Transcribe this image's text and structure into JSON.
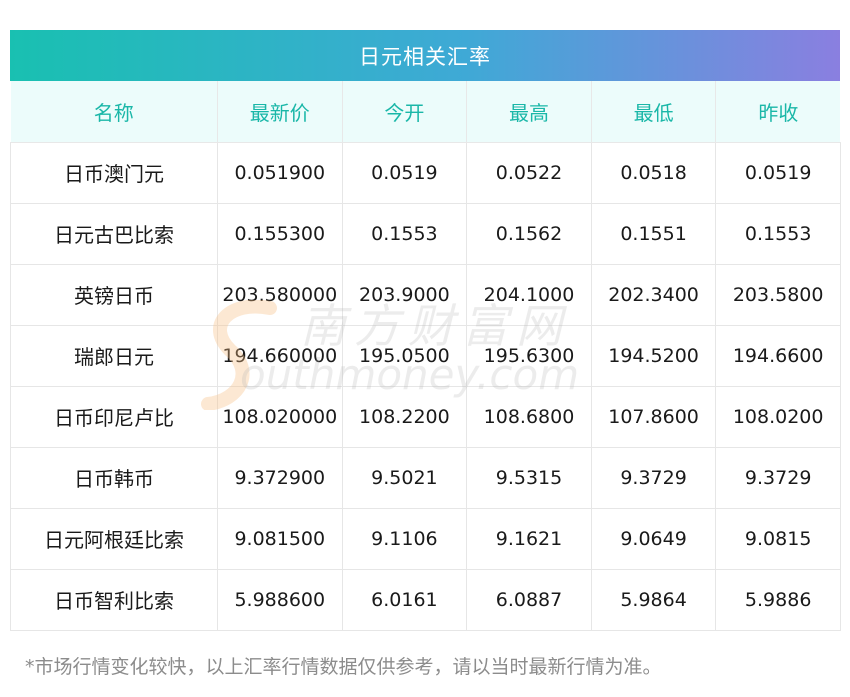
{
  "title": "日元相关汇率",
  "headers": [
    "名称",
    "最新价",
    "今开",
    "最高",
    "最低",
    "昨收"
  ],
  "rows": [
    [
      "日币澳门元",
      "0.051900",
      "0.0519",
      "0.0522",
      "0.0518",
      "0.0519"
    ],
    [
      "日元古巴比索",
      "0.155300",
      "0.1553",
      "0.1562",
      "0.1551",
      "0.1553"
    ],
    [
      "英镑日币",
      "203.580000",
      "203.9000",
      "204.1000",
      "202.3400",
      "203.5800"
    ],
    [
      "瑞郎日元",
      "194.660000",
      "195.0500",
      "195.6300",
      "194.5200",
      "194.6600"
    ],
    [
      "日币印尼卢比",
      "108.020000",
      "108.2200",
      "108.6800",
      "107.8600",
      "108.0200"
    ],
    [
      "日币韩币",
      "9.372900",
      "9.5021",
      "9.5315",
      "9.3729",
      "9.3729"
    ],
    [
      "日元阿根廷比索",
      "9.081500",
      "9.1106",
      "9.1621",
      "9.0649",
      "9.0815"
    ],
    [
      "日币智利比索",
      "5.988600",
      "6.0161",
      "6.0887",
      "5.9864",
      "5.9886"
    ]
  ],
  "watermark": {
    "cn": "南方财富网",
    "en": "outhmoney.com"
  },
  "footnote": "*市场行情变化较快，以上汇率行情数据仅供参考，请以当时最新行情为准。",
  "colors": {
    "header_text": "#1ab7a8",
    "header_bg": "#ecfcfb",
    "title_gradient_start": "#19c0b1",
    "title_gradient_end": "#8a7fe0"
  }
}
